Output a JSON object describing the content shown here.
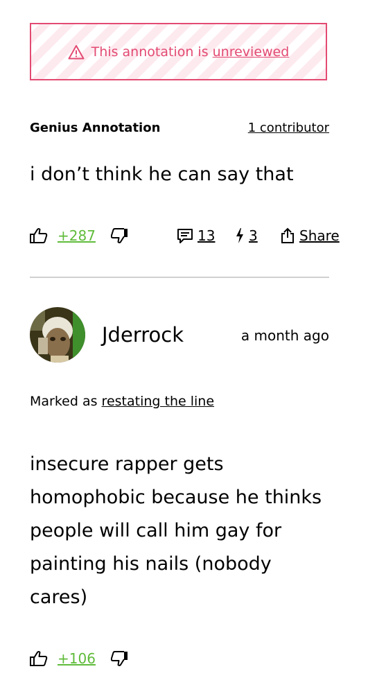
{
  "banner": {
    "text": "This annotation is ",
    "link": "unreviewed",
    "icon": "warning-icon",
    "color": "#e34a72"
  },
  "annotation": {
    "label": "Genius Annotation",
    "contributors": "1 contributor",
    "body": "i don’t think he can say that",
    "votes": "+287",
    "comments": "13",
    "echoes": "3",
    "share": "Share"
  },
  "comment": {
    "username": "Jderrock",
    "timestamp": "a month ago",
    "marked_prefix": "Marked as ",
    "marked_link": "restating the line",
    "body": "insecure rapper gets homophobic because he thinks people will call him gay for painting his nails (nobody cares)",
    "votes": "+106"
  },
  "colors": {
    "upvote_green": "#5fbb3a",
    "divider": "#d0d0d0"
  }
}
